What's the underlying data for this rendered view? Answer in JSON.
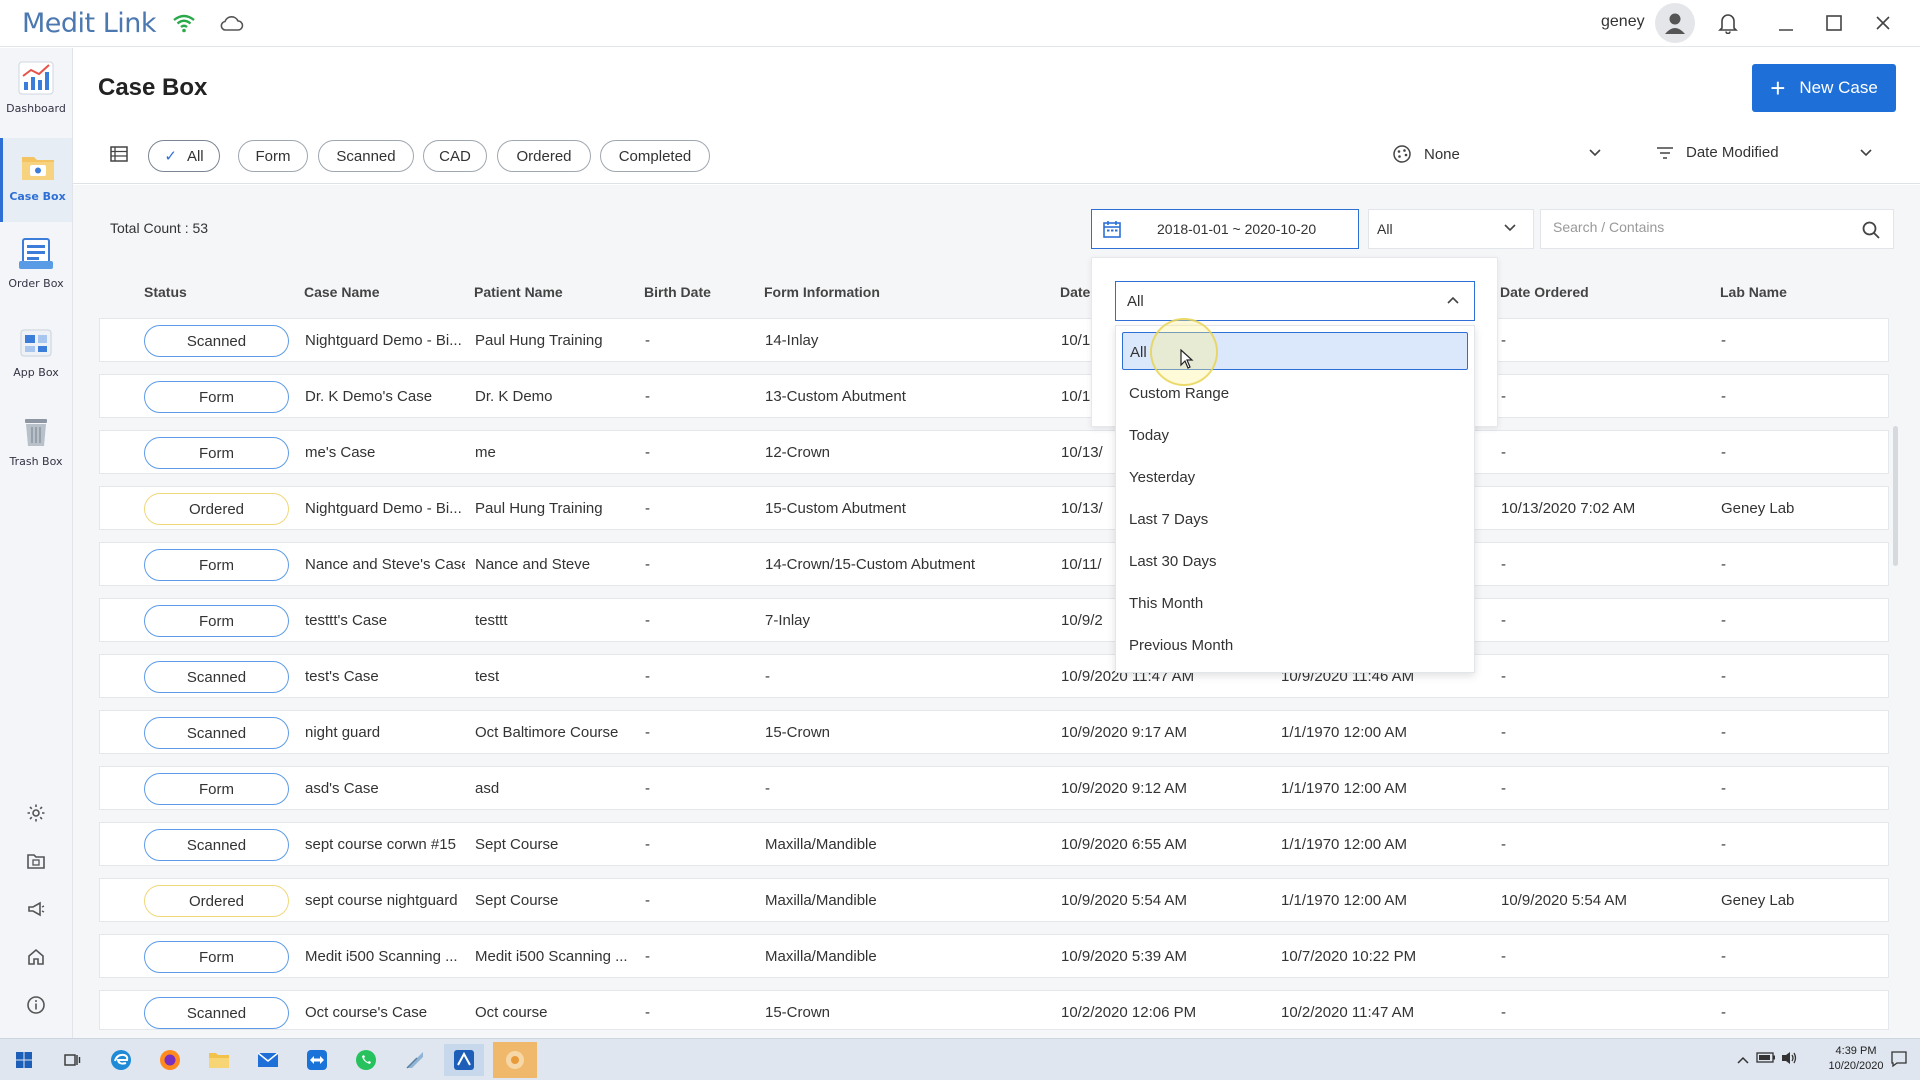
{
  "app": {
    "title": "Medit Link",
    "user_name": "geney"
  },
  "sidebar": {
    "items": [
      {
        "label": "Dashboard",
        "icon": "dashboard-chart-icon"
      },
      {
        "label": "Case Box",
        "icon": "case-box-icon",
        "active": true
      },
      {
        "label": "Order Box",
        "icon": "order-box-icon"
      },
      {
        "label": "App Box",
        "icon": "app-box-icon"
      },
      {
        "label": "Trash Box",
        "icon": "trash-box-icon"
      }
    ],
    "bottom_icons": [
      "settings-icon",
      "folder-icon",
      "megaphone-icon",
      "home-icon",
      "info-icon"
    ]
  },
  "page": {
    "title": "Case Box",
    "new_case_label": "New Case"
  },
  "filters": {
    "chips": [
      {
        "label": "All",
        "active": true
      },
      {
        "label": "Form"
      },
      {
        "label": "Scanned"
      },
      {
        "label": "CAD"
      },
      {
        "label": "Ordered"
      },
      {
        "label": "Completed"
      }
    ],
    "group_by": "None",
    "sort_by": "Date Modified"
  },
  "toolbar": {
    "total_count": "Total Count : 53",
    "date_range": "2018-01-01 ~ 2020-10-20",
    "type_select": "All",
    "search_placeholder": "Search / Contains"
  },
  "table": {
    "headers": {
      "status": "Status",
      "case_name": "Case Name",
      "patient_name": "Patient Name",
      "birth_date": "Birth Date",
      "form_info": "Form Information",
      "date": "Date",
      "date_ordered": "Date Ordered",
      "lab_name": "Lab Name"
    },
    "rows": [
      {
        "status": "Scanned",
        "case_name": "Nightguard Demo - Bi...",
        "patient": "Paul Hung Training",
        "birth": "-",
        "form": "14-Inlay",
        "date1": "10/1",
        "date2": "",
        "ordered": "-",
        "lab": "-"
      },
      {
        "status": "Form",
        "case_name": "Dr. K Demo's Case",
        "patient": "Dr. K Demo",
        "birth": "-",
        "form": "13-Custom Abutment",
        "date1": "10/1",
        "date2": "",
        "ordered": "-",
        "lab": "-"
      },
      {
        "status": "Form",
        "case_name": "me's Case",
        "patient": "me",
        "birth": "-",
        "form": "12-Crown",
        "date1": "10/13/",
        "date2": "",
        "ordered": "-",
        "lab": "-"
      },
      {
        "status": "Ordered",
        "case_name": "Nightguard Demo - Bi...",
        "patient": "Paul Hung Training",
        "birth": "-",
        "form": "15-Custom Abutment",
        "date1": "10/13/",
        "date2": "",
        "ordered": "10/13/2020 7:02 AM",
        "lab": "Geney Lab"
      },
      {
        "status": "Form",
        "case_name": "Nance and Steve's Case",
        "patient": "Nance and Steve",
        "birth": "-",
        "form": "14-Crown/15-Custom Abutment",
        "date1": "10/11/",
        "date2": "",
        "ordered": "-",
        "lab": "-"
      },
      {
        "status": "Form",
        "case_name": "testtt's Case",
        "patient": "testtt",
        "birth": "-",
        "form": "7-Inlay",
        "date1": "10/9/2",
        "date2": "",
        "ordered": "-",
        "lab": "-"
      },
      {
        "status": "Scanned",
        "case_name": "test's Case",
        "patient": "test",
        "birth": "-",
        "form": "-",
        "date1": "10/9/2020 11:47 AM",
        "date2": "10/9/2020 11:46 AM",
        "ordered": "-",
        "lab": "-"
      },
      {
        "status": "Scanned",
        "case_name": "night guard",
        "patient": "Oct Baltimore Course",
        "birth": "-",
        "form": "15-Crown",
        "date1": "10/9/2020 9:17 AM",
        "date2": "1/1/1970 12:00 AM",
        "ordered": "-",
        "lab": "-"
      },
      {
        "status": "Form",
        "case_name": "asd's Case",
        "patient": "asd",
        "birth": "-",
        "form": "-",
        "date1": "10/9/2020 9:12 AM",
        "date2": "1/1/1970 12:00 AM",
        "ordered": "-",
        "lab": "-"
      },
      {
        "status": "Scanned",
        "case_name": "sept course corwn #15",
        "patient": "Sept Course",
        "birth": "-",
        "form": "Maxilla/Mandible",
        "date1": "10/9/2020 6:55 AM",
        "date2": "1/1/1970 12:00 AM",
        "ordered": "-",
        "lab": "-"
      },
      {
        "status": "Ordered",
        "case_name": "sept course nightguard",
        "patient": "Sept Course",
        "birth": "-",
        "form": "Maxilla/Mandible",
        "date1": "10/9/2020 5:54 AM",
        "date2": "1/1/1970 12:00 AM",
        "ordered": "10/9/2020 5:54 AM",
        "lab": "Geney Lab"
      },
      {
        "status": "Form",
        "case_name": "Medit i500 Scanning ...",
        "patient": "Medit i500 Scanning ...",
        "birth": "-",
        "form": "Maxilla/Mandible",
        "date1": "10/9/2020 5:39 AM",
        "date2": "10/7/2020 10:22 PM",
        "ordered": "-",
        "lab": "-"
      },
      {
        "status": "Scanned",
        "case_name": "Oct course's Case",
        "patient": "Oct course",
        "birth": "-",
        "form": "15-Crown",
        "date1": "10/2/2020 12:06 PM",
        "date2": "10/2/2020 11:47 AM",
        "ordered": "-",
        "lab": "-"
      }
    ]
  },
  "date_dropdown": {
    "selected": "All",
    "options": [
      "All",
      "Custom Range",
      "Today",
      "Yesterday",
      "Last 7 Days",
      "Last 30 Days",
      "This Month",
      "Previous Month"
    ]
  },
  "taskbar": {
    "apps": [
      "windows-start-icon",
      "task-view-icon",
      "edge-icon",
      "firefox-icon",
      "file-explorer-icon",
      "mail-icon",
      "teamviewer-icon",
      "whatsapp-icon",
      "app-icon",
      "medit-link-icon",
      "active-app-icon"
    ],
    "time": "4:39 PM",
    "date": "10/20/2020"
  },
  "colors": {
    "accent": "#1f6fd8",
    "scanned_border": "#5d9be8",
    "ordered_border": "#f0d77a",
    "selected_option_bg": "#dbe8fb"
  }
}
